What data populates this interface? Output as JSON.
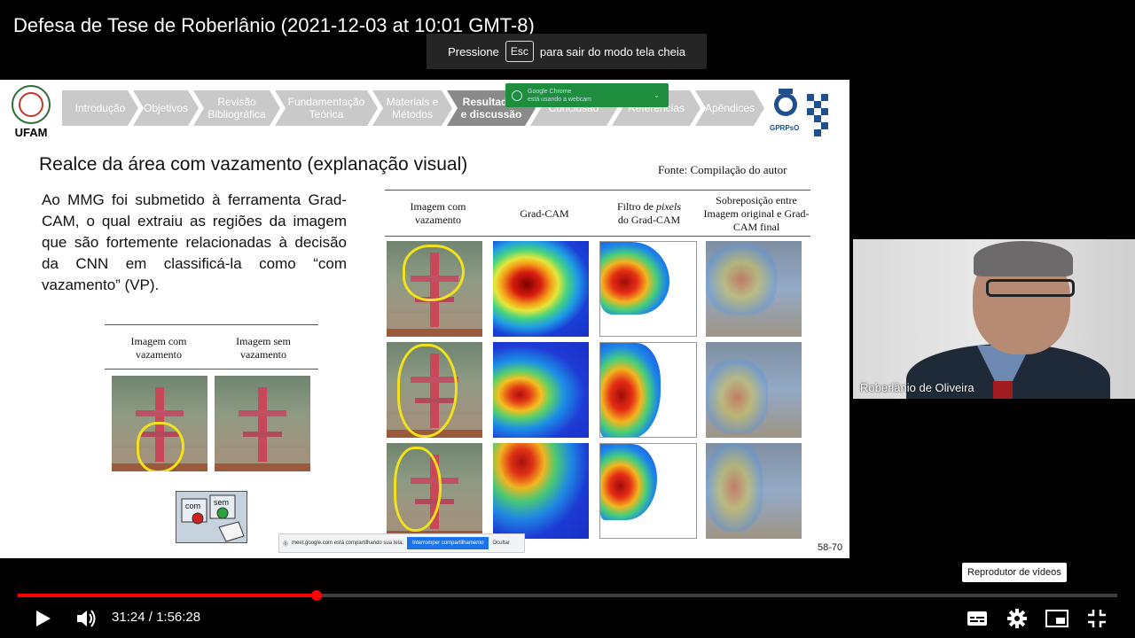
{
  "video": {
    "title": "Defesa de Tese de Roberlânio (2021-12-03 at 10:01 GMT-8)",
    "fullscreen_hint": {
      "before": "Pressione",
      "key": "Esc",
      "after": "para sair do modo tela cheia"
    },
    "current_time": "31:24",
    "duration": "1:56:28",
    "progress_fraction": 0.272,
    "tooltip": "Reprodutor de vídeos",
    "accent_color": "#ff0000"
  },
  "slide": {
    "logo_left": "UFAM",
    "logo_right": "GPRPsO",
    "nav": [
      {
        "label": "Introdução",
        "active": false
      },
      {
        "label": "Objetivos",
        "active": false
      },
      {
        "label": "Revisão Bibliográfica",
        "active": false
      },
      {
        "label": "Fundamentação Teórica",
        "active": false
      },
      {
        "label": "Materiais e Métodos",
        "active": false
      },
      {
        "label": "Resultados e discussão",
        "active": true
      },
      {
        "label": "Conclusão",
        "active": false
      },
      {
        "label": "Referências",
        "active": false
      },
      {
        "label": "Apêndices",
        "active": false
      }
    ],
    "webcam_notice": {
      "line1": "Google Chrome",
      "line2": "está usando a webcam"
    },
    "title": "Realce da área com vazamento (explanação visual)",
    "source": "Fonte: Compilação do autor",
    "body": "Ao MMG foi submetido à ferramenta Grad-CAM, o qual extraiu as regiões da imagem que são fortemente relacionadas à decisão da CNN em classificá-la como “com vazamento” (VP).",
    "left_table": {
      "headers": [
        "Imagem com vazamento",
        "Imagem sem vazamento"
      ]
    },
    "right_table": {
      "headers": [
        "Imagem com vazamento",
        "Grad-CAM",
        "Filtro de pixels do Grad-CAM",
        "Sobreposição entre Imagem original e Grad-CAM final"
      ],
      "header3_parts": {
        "pre": "Filtro de ",
        "italic": "pixels",
        "post": "do Grad-CAM"
      }
    },
    "buttons_icon": {
      "com": "com",
      "sem": "sem"
    },
    "share_bar": {
      "text": "meet.google.com está compartilhando sua tela.",
      "stop": "Interromper compartilhamento",
      "hide": "Ocultar"
    },
    "slide_number": "58-70"
  },
  "participant": {
    "name": "Roberlânio de Oliveira"
  },
  "icons": {
    "play": "play-icon",
    "volume": "volume-icon",
    "subtitles": "subtitles-icon",
    "settings": "gear-icon",
    "miniplayer": "miniplayer-icon",
    "exit_fullscreen": "exit-fullscreen-icon"
  }
}
